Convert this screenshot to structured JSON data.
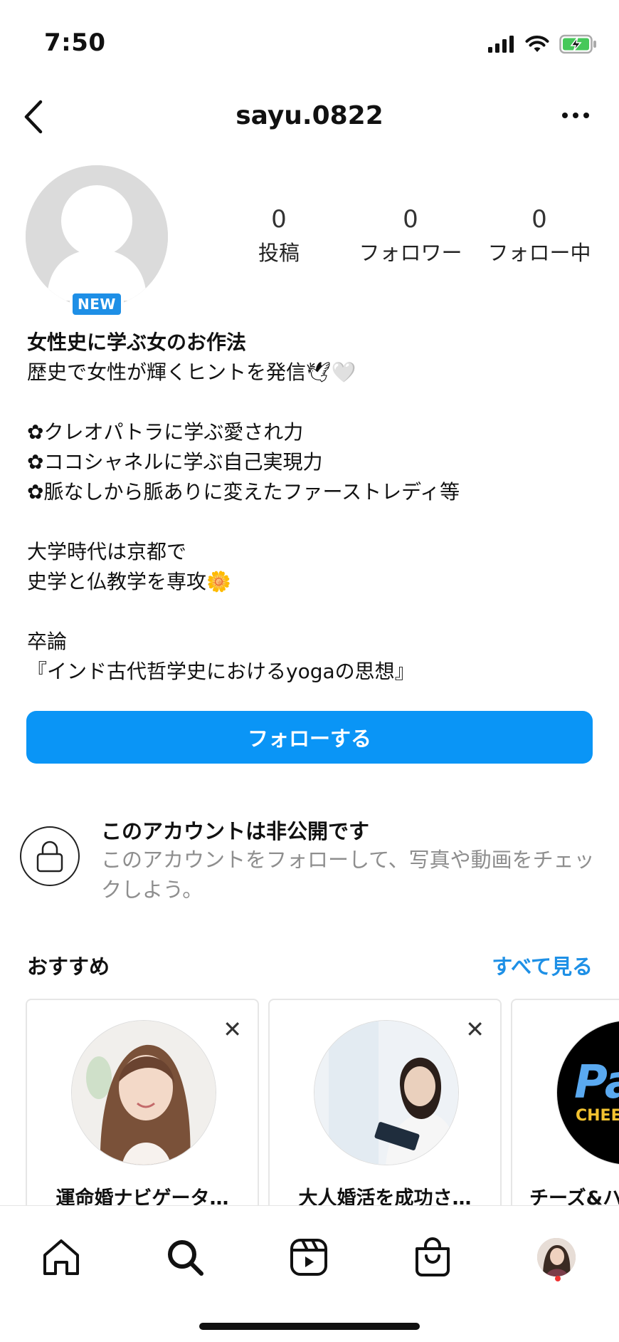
{
  "status": {
    "time": "7:50"
  },
  "header": {
    "username": "sayu.0822"
  },
  "profile": {
    "badge": "NEW",
    "stats": [
      {
        "value": "0",
        "label": "投稿"
      },
      {
        "value": "0",
        "label": "フォロワー"
      },
      {
        "value": "0",
        "label": "フォロー中"
      }
    ]
  },
  "bio": {
    "name": "女性史に学ぶ女のお作法",
    "lines": [
      "歴史で女性が輝くヒントを発信🕊🤍",
      "",
      "✿クレオパトラに学ぶ愛され力",
      "✿ココシャネルに学ぶ自己実現力",
      "✿脈なしから脈ありに変えたファーストレディ等",
      "",
      "大学時代は京都で",
      "史学と仏教学を専攻🌼",
      "",
      "卒論",
      "『インド古代哲学史におけるyogaの思想』"
    ]
  },
  "actions": {
    "follow_label": "フォローする"
  },
  "private_notice": {
    "title": "このアカウントは非公開です",
    "description": "このアカウントをフォローして、写真や動画をチェックしよう。"
  },
  "suggestions": {
    "title": "おすすめ",
    "see_all": "すべて見る",
    "cards": [
      {
        "name": "運命婚ナビゲータ…",
        "close": "✕"
      },
      {
        "name": "大人婚活を成功さ…",
        "close": "✕"
      },
      {
        "name": "チーズ&ハ",
        "photo_text_1": "Pa",
        "photo_text_2": "CHEES"
      }
    ]
  },
  "colors": {
    "accent": "#0a95f6",
    "link": "#1e90e6",
    "badge": "#1e8fe6"
  }
}
